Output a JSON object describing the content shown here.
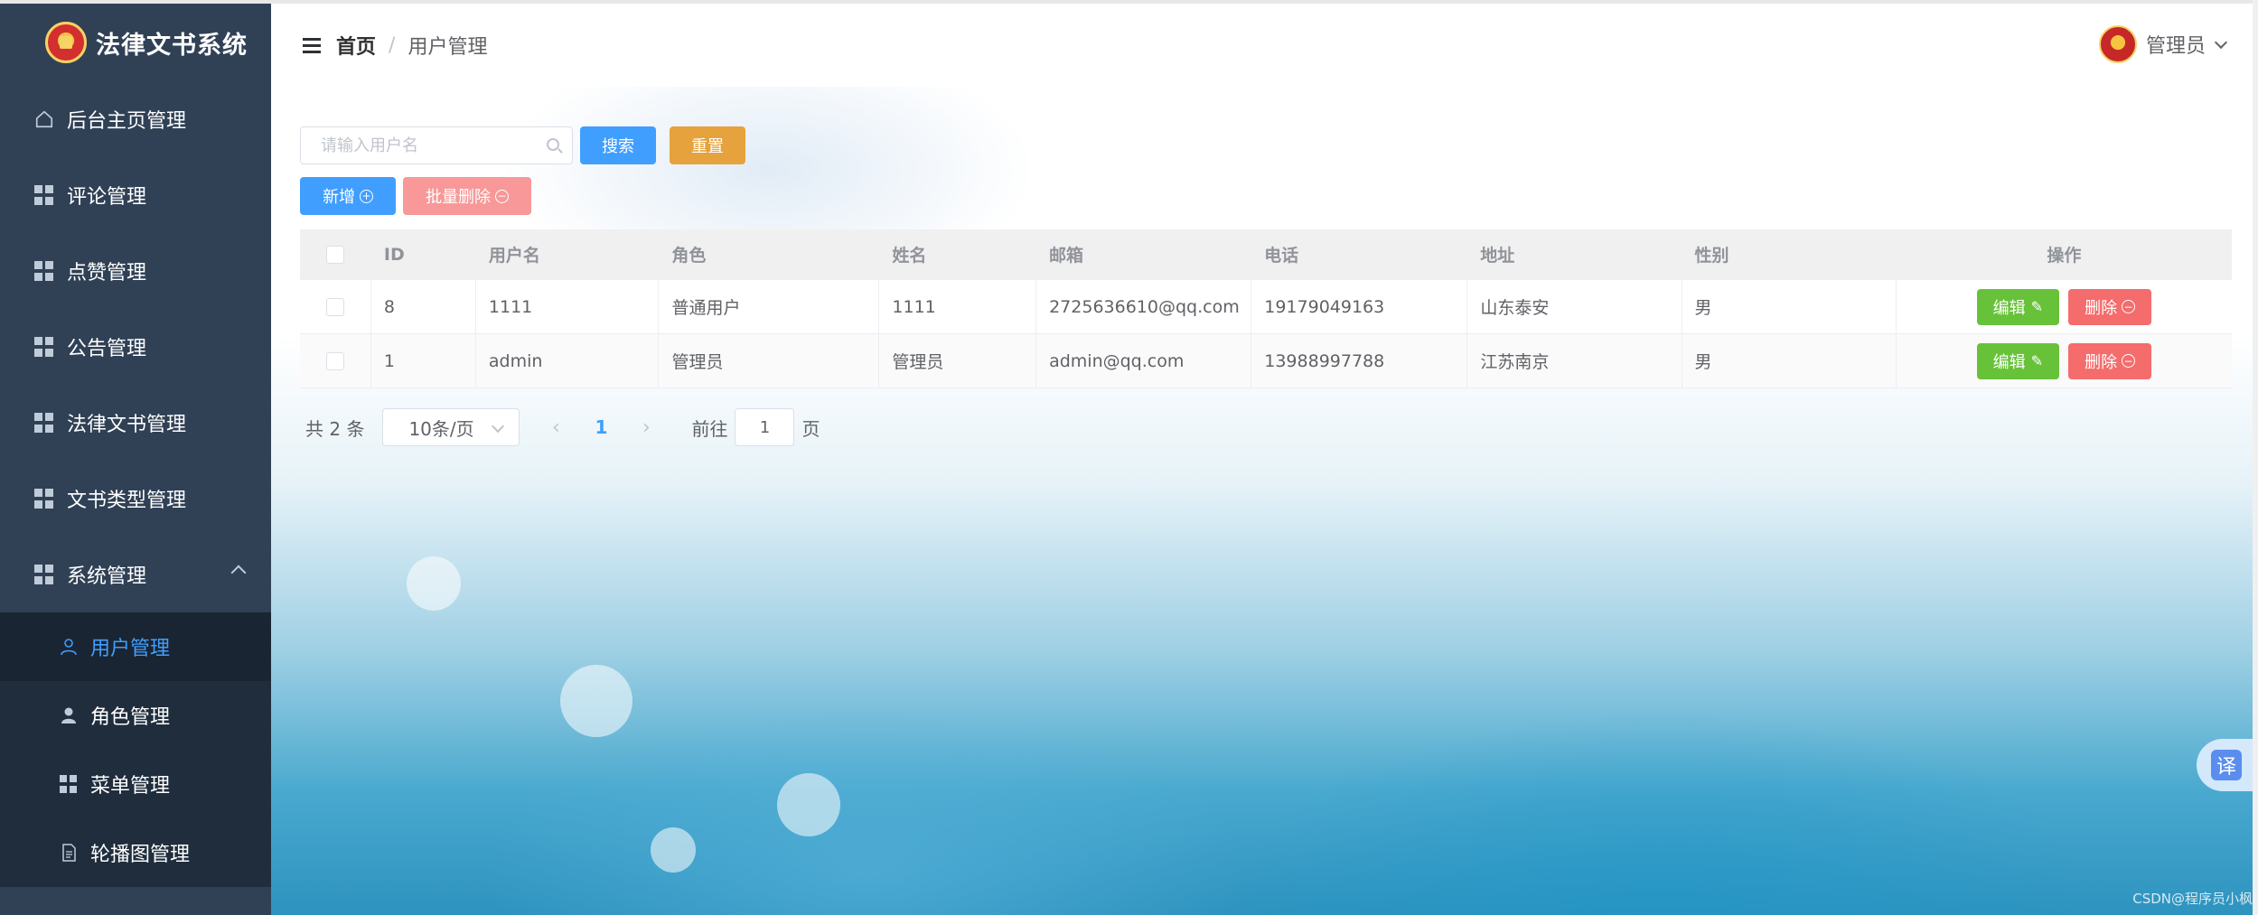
{
  "app": {
    "title": "法律文书系统"
  },
  "sidebar": {
    "items": [
      {
        "label": "后台主页管理",
        "icon": "home-icon"
      },
      {
        "label": "评论管理",
        "icon": "grid-icon"
      },
      {
        "label": "点赞管理",
        "icon": "grid-icon"
      },
      {
        "label": "公告管理",
        "icon": "grid-icon"
      },
      {
        "label": "法律文书管理",
        "icon": "grid-icon"
      },
      {
        "label": "文书类型管理",
        "icon": "grid-icon"
      },
      {
        "label": "系统管理",
        "icon": "grid-icon",
        "expanded": true
      }
    ],
    "submenu": [
      {
        "label": "用户管理",
        "icon": "user-outline-icon",
        "active": true
      },
      {
        "label": "角色管理",
        "icon": "user-filled-icon"
      },
      {
        "label": "菜单管理",
        "icon": "grid-icon"
      },
      {
        "label": "轮播图管理",
        "icon": "document-icon"
      }
    ]
  },
  "header": {
    "breadcrumb_home": "首页",
    "breadcrumb_sep": "/",
    "breadcrumb_current": "用户管理",
    "user_name": "管理员"
  },
  "toolbar": {
    "search_placeholder": "请输入用户名",
    "search_label": "搜索",
    "reset_label": "重置",
    "add_label": "新增",
    "batch_delete_label": "批量删除"
  },
  "table": {
    "columns": [
      "ID",
      "用户名",
      "角色",
      "姓名",
      "邮箱",
      "电话",
      "地址",
      "性别",
      "操作"
    ],
    "rows": [
      {
        "id": "8",
        "username": "1111",
        "role": "普通用户",
        "name": "1111",
        "email": "2725636610@qq.com",
        "phone": "19179049163",
        "address": "山东泰安",
        "gender": "男"
      },
      {
        "id": "1",
        "username": "admin",
        "role": "管理员",
        "name": "管理员",
        "email": "admin@qq.com",
        "phone": "13988997788",
        "address": "江苏南京",
        "gender": "男"
      }
    ],
    "edit_label": "编辑",
    "delete_label": "删除"
  },
  "pagination": {
    "total_text": "共 2 条",
    "page_size": "10条/页",
    "current_page": "1",
    "goto_prefix": "前往",
    "goto_value": "1",
    "goto_suffix": "页"
  },
  "translate": {
    "label": "译"
  },
  "watermark": "CSDN@程序员小枫"
}
